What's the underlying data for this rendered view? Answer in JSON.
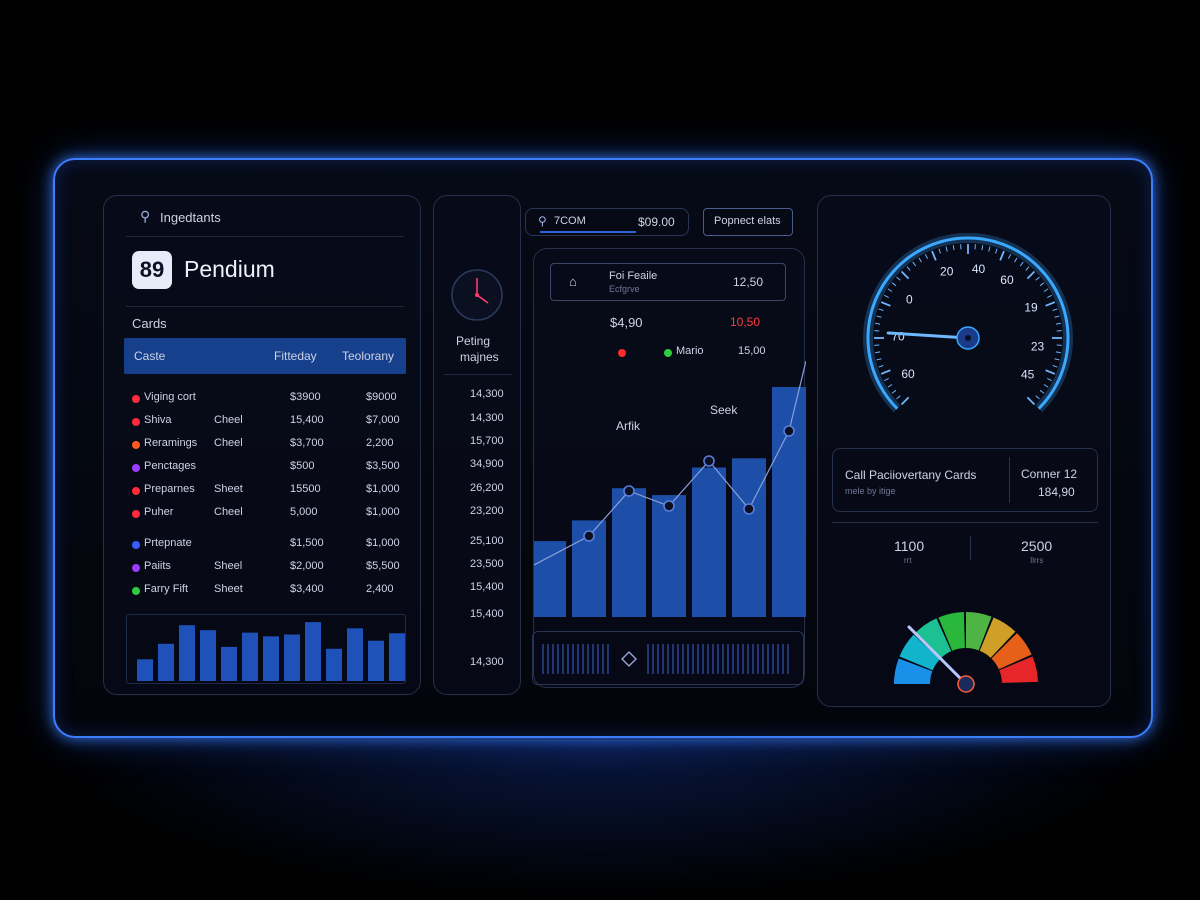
{
  "left": {
    "search_label": "Ingedtants",
    "logo_number": "89",
    "app_name": "Pendium",
    "section_title": "Cards",
    "table_headers": [
      "Caste",
      "Fitteday",
      "Teolorany"
    ],
    "rows": [
      {
        "name": "Viging cort",
        "type": "",
        "v1": "$3900",
        "v2": "$9000",
        "color": "#ff2a3a"
      },
      {
        "name": "Shiva",
        "type": "Cheel",
        "v1": "15,400",
        "v2": "$7,000",
        "color": "#ff2a3a"
      },
      {
        "name": "Reramings",
        "type": "Cheel",
        "v1": "$3,700",
        "v2": "2,200",
        "color": "#ff5a1f"
      },
      {
        "name": "Penctages",
        "type": "",
        "v1": "$500",
        "v2": "$3,500",
        "color": "#9a3cff"
      },
      {
        "name": "Preparnes",
        "type": "Sheet",
        "v1": "15500",
        "v2": "$1,000",
        "color": "#ff2a3a"
      },
      {
        "name": "Puher",
        "type": "Cheel",
        "v1": "5,000",
        "v2": "$1,000",
        "color": "#ff2a3a"
      },
      {
        "name": "Prtepnate",
        "type": "",
        "v1": "$1,500",
        "v2": "$1,000",
        "color": "#3a5cff"
      },
      {
        "name": "Paiits",
        "type": "Sheel",
        "v1": "$2,000",
        "v2": "$5,500",
        "color": "#9a3cff"
      },
      {
        "name": "Farry Fift",
        "type": "Sheet",
        "v1": "$3,400",
        "v2": "2,400",
        "color": "#2ecc40"
      }
    ],
    "mini_bars": [
      0.35,
      0.6,
      0.9,
      0.82,
      0.55,
      0.78,
      0.72,
      0.75,
      0.95,
      0.52,
      0.85,
      0.65,
      0.77
    ]
  },
  "mid_left": {
    "label_line1": "Peting",
    "label_line2": "majnes",
    "values": [
      "14,300",
      "14,300",
      "15,700",
      "34,900",
      "26,200",
      "23,200",
      "25,100",
      "23,500",
      "15,400",
      "15,400",
      "14,300"
    ]
  },
  "center": {
    "search_text": "7COM",
    "search_value": "$09.00",
    "button_label": "Popnect elats",
    "info_title": "Foi Feaile",
    "info_sub": "Ecfgrve",
    "info_value": "12,50",
    "stat_left": "$4,90",
    "stat_right": "10,50",
    "legend_label": "Mario",
    "legend_value": "15,00",
    "annotation_1": "Arfik",
    "annotation_2": "Seek",
    "chart_data": {
      "type": "bar",
      "values": [
        0.33,
        0.42,
        0.56,
        0.53,
        0.65,
        0.69,
        1.0
      ],
      "line": [
        0.1,
        0.3,
        0.6,
        0.5,
        0.8,
        0.48,
        1.0
      ]
    },
    "colors": {
      "bar": "#1d4fa8",
      "line": "#8aa0d8",
      "accent_red": "#ff3a3a",
      "accent_green": "#2ecc40"
    }
  },
  "right": {
    "speed_ticks": [
      "20",
      "40",
      "60",
      "19",
      "23",
      "45",
      "60",
      "70",
      "0"
    ],
    "speed_value": 0.18,
    "card_title": "Call Paciiovertany Cards",
    "card_sub": "mele by itige",
    "card_right_title": "Conner 12",
    "card_right_value": "184,90",
    "stat_a": "1100",
    "stat_a_sub": "rrt",
    "stat_b": "2500",
    "stat_b_sub": "Ilrrs",
    "gauge_value": 0.25,
    "gauge_colors": [
      "#1ea0ff",
      "#14c8e0",
      "#1ed6a0",
      "#2ecc40",
      "#57c94a",
      "#e6b02a",
      "#ff6a1a",
      "#ff2a2a"
    ]
  }
}
